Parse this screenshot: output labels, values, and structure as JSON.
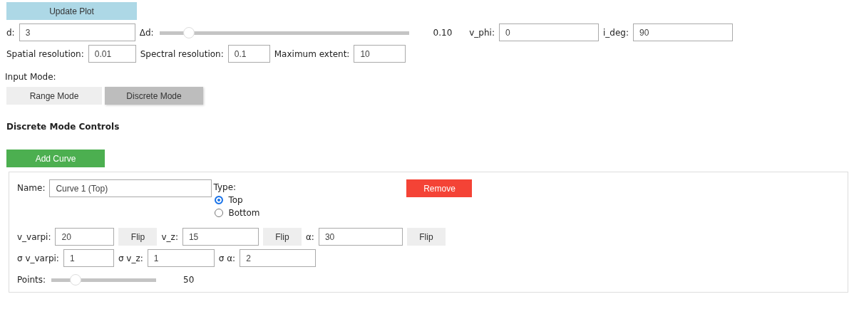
{
  "update_button": {
    "label": "Update Plot"
  },
  "parameter_rows": [
    [
      {
        "kind": "input",
        "label": "d:",
        "value": "3"
      },
      {
        "kind": "slider",
        "label": "Δd:",
        "level": 0.1,
        "reading": "0.10"
      },
      {
        "kind": "input",
        "label": "v_phi:",
        "value": "0"
      },
      {
        "kind": "input",
        "label": "i_deg:",
        "value": "90"
      }
    ],
    [
      {
        "kind": "input",
        "label": "Spatial resolution:",
        "value": "0.01"
      },
      {
        "kind": "input",
        "label": "Spectral resolution:",
        "value": "0.1"
      },
      {
        "kind": "input",
        "label": "Maximum extent:",
        "value": "10"
      }
    ]
  ],
  "input_mode": {
    "label": "Input Mode:",
    "options": [
      {
        "label": "Range Mode",
        "selected": false
      },
      {
        "label": "Discrete Mode",
        "selected": true
      }
    ]
  },
  "section_title": "Discrete Mode Controls",
  "add_button": {
    "label": "Add Curve"
  },
  "curves": [
    {
      "name_label": "Name:",
      "name": "Curve 1 (Top)",
      "type_label": "Type:",
      "remove_label": "Remove",
      "types": [
        {
          "label": "Top",
          "selected": true
        },
        {
          "label": "Bottom",
          "selected": false
        }
      ],
      "rows": [
        [
          {
            "kind": "input",
            "label": "v_varpi:",
            "value": "20"
          },
          {
            "kind": "button",
            "label": "Flip"
          },
          {
            "kind": "input",
            "label": "v_z:",
            "value": "15"
          },
          {
            "kind": "button",
            "label": "Flip"
          },
          {
            "kind": "input",
            "label": "α:",
            "value": "30"
          },
          {
            "kind": "button",
            "label": "Flip"
          }
        ],
        [
          {
            "kind": "input",
            "label": "σ v_varpi:",
            "value": "1"
          },
          {
            "kind": "input",
            "label": "σ v_z:",
            "value": "1"
          },
          {
            "kind": "input",
            "label": "σ α:",
            "value": "2"
          }
        ],
        [
          {
            "kind": "slider",
            "label": "Points:",
            "level": 0.2,
            "reading": "50"
          }
        ]
      ]
    }
  ]
}
